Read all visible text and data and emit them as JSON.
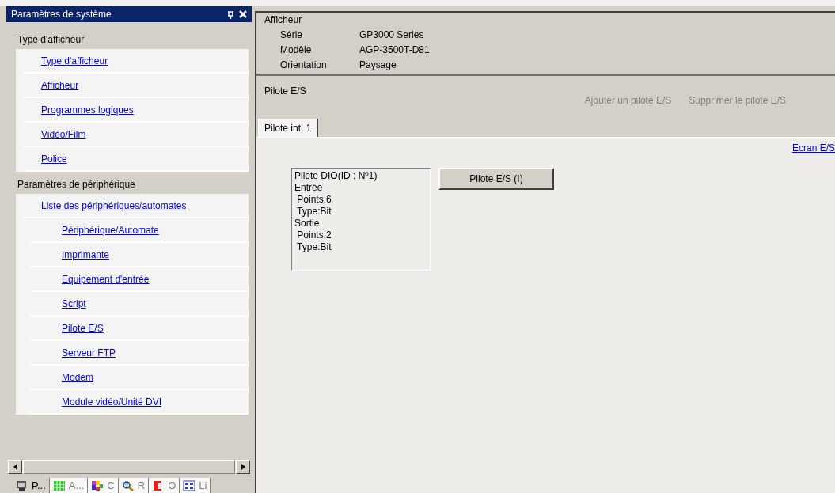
{
  "panel": {
    "title": "Paramètres de système"
  },
  "sections": [
    {
      "heading": "Type d'afficheur",
      "items": [
        {
          "label": "Type d'afficheur"
        },
        {
          "label": "Afficheur"
        },
        {
          "label": "Programmes logiques"
        },
        {
          "label": "Vidéo/Film"
        },
        {
          "label": "Police"
        }
      ]
    },
    {
      "heading": "Paramètres de périphérique",
      "items": [
        {
          "label": "Liste des périphériques/automates",
          "children": [
            {
              "label": "Périphérique/Automate"
            },
            {
              "label": "Imprimante"
            },
            {
              "label": "Equipement d'entrée"
            },
            {
              "label": "Script"
            },
            {
              "label": "Pilote E/S"
            },
            {
              "label": "Serveur FTP"
            },
            {
              "label": "Modem"
            },
            {
              "label": "Module vidéo/Unité DVI"
            }
          ]
        }
      ]
    }
  ],
  "bottom_tabs": [
    {
      "label": "P...",
      "kind": "monitor",
      "selected": true
    },
    {
      "label": "A...",
      "kind": "grid",
      "selected": false
    },
    {
      "label": "C",
      "kind": "colors",
      "selected": false
    },
    {
      "label": "R",
      "kind": "search",
      "selected": false
    },
    {
      "label": "O",
      "kind": "book",
      "selected": false
    },
    {
      "label": "Li",
      "kind": "tiles",
      "selected": false
    }
  ],
  "display": {
    "heading": "Afficheur",
    "rows": [
      {
        "label": "Série",
        "value": "GP3000 Series"
      },
      {
        "label": "Modèle",
        "value": "AGP-3500T-D81"
      },
      {
        "label": "Orientation",
        "value": "Paysage"
      }
    ]
  },
  "io": {
    "heading": "Pilote E/S",
    "actions": [
      {
        "label": "Ajouter un pilote E/S",
        "disabled": true
      },
      {
        "label": "Supprimer le pilote E/S",
        "disabled": true
      }
    ],
    "tabs": [
      {
        "label": "Pilote int. 1",
        "selected": true
      }
    ],
    "link": "Ecran E/S",
    "info_lines": [
      "Pilote DIO(ID : Nº1)",
      "Entrée",
      " Points:6",
      " Type:Bit",
      "Sortie",
      " Points:2",
      " Type:Bit"
    ],
    "driver_button": "Pilote E/S (I)"
  }
}
